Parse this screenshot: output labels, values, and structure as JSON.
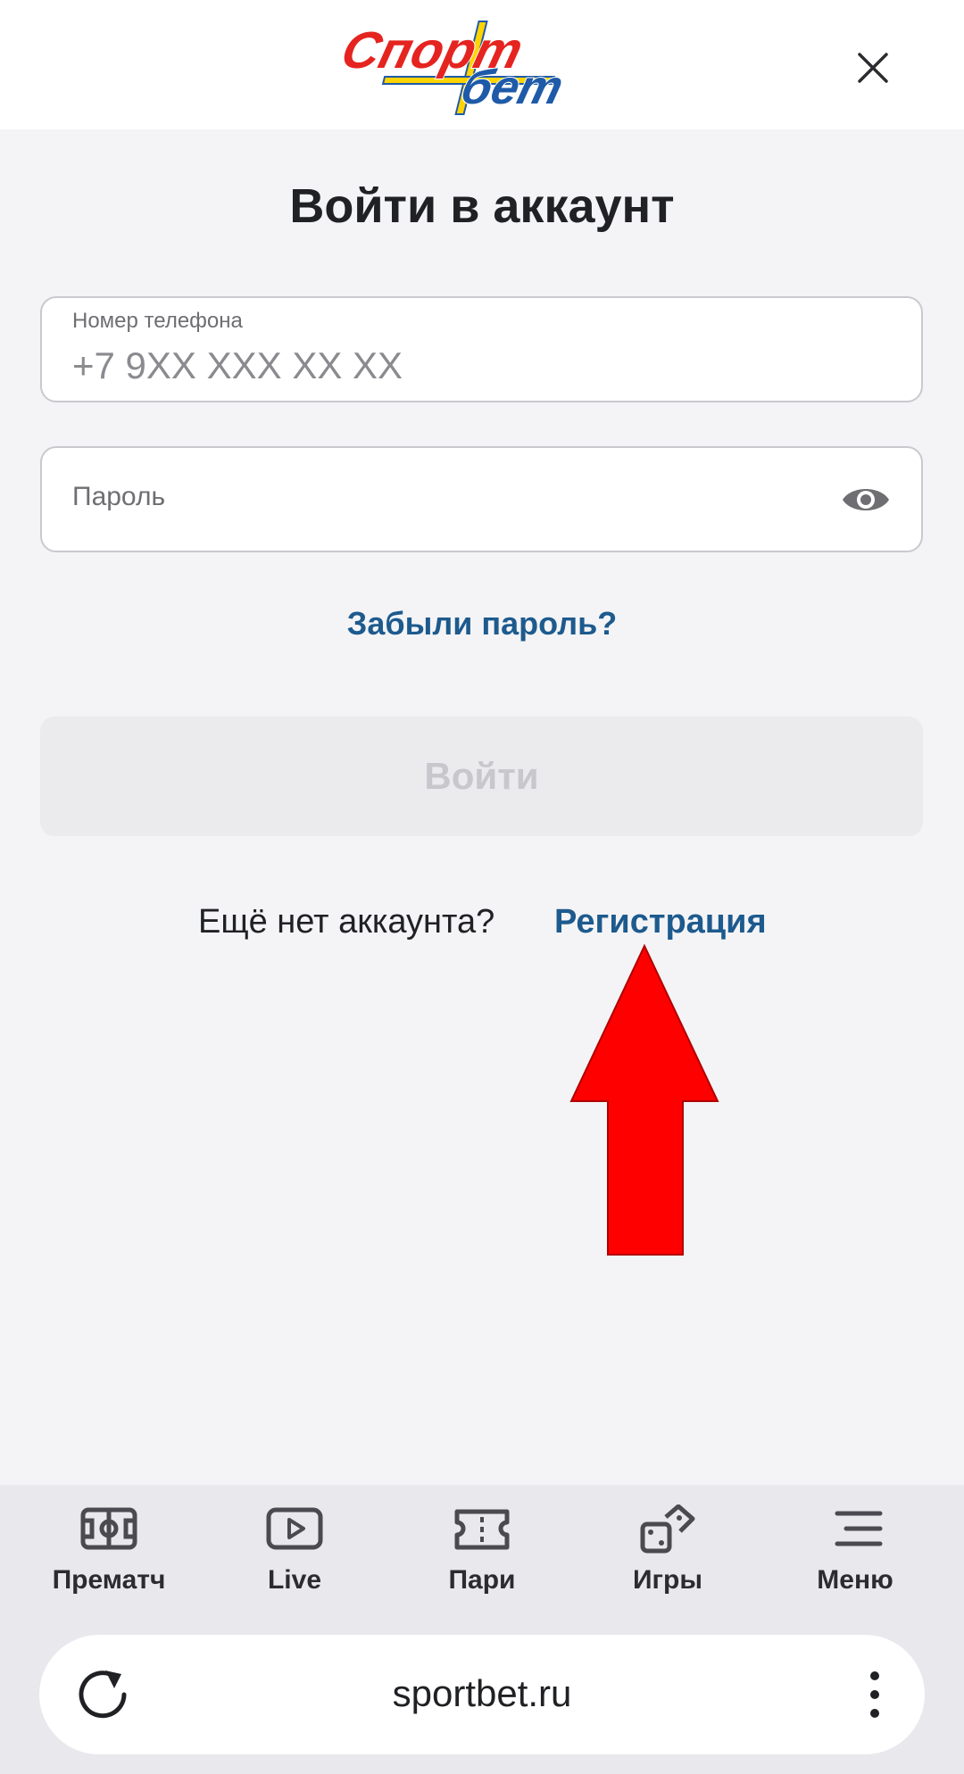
{
  "header": {
    "logo_text_top": "Спорт",
    "logo_text_bottom": "бет",
    "close_icon": "close-icon"
  },
  "login": {
    "title": "Войти в аккаунт",
    "phone_label": "Номер телефона",
    "phone_placeholder": "+7 9XX XXX XX XX",
    "password_placeholder": "Пароль",
    "password_icon": "eye-icon",
    "forgot_password": "Забыли пароль?",
    "submit_label": "Войти",
    "no_account_text": "Ещё нет аккаунта?",
    "register_link": "Регистрация"
  },
  "annotation": {
    "arrow_color": "#ff0000"
  },
  "bottom_nav": {
    "items": [
      {
        "label": "Прематч",
        "icon": "field-icon"
      },
      {
        "label": "Live",
        "icon": "play-icon"
      },
      {
        "label": "Пари",
        "icon": "ticket-icon"
      },
      {
        "label": "Игры",
        "icon": "dice-icon"
      },
      {
        "label": "Меню",
        "icon": "menu-icon"
      }
    ]
  },
  "browser": {
    "url": "sportbet.ru",
    "reload_icon": "reload-icon",
    "more_icon": "more-vertical-icon"
  },
  "colors": {
    "link": "#1d5a8e",
    "background": "#f4f4f6",
    "logo_red": "#e52420",
    "logo_blue": "#1e5aa8",
    "logo_yellow": "#ffd400"
  }
}
